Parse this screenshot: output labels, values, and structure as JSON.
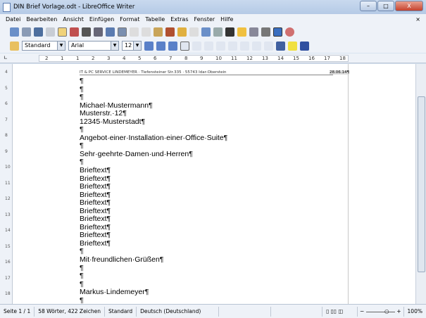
{
  "window": {
    "title": "DIN Brief Vorlage.odt - LibreOffice Writer",
    "minimize": "–",
    "maximize": "□",
    "close": "X"
  },
  "menu": [
    "Datei",
    "Bearbeiten",
    "Ansicht",
    "Einfügen",
    "Format",
    "Tabelle",
    "Extras",
    "Fenster",
    "Hilfe"
  ],
  "menu_close": "×",
  "format": {
    "style": "Standard",
    "font": "Arial",
    "size": "12"
  },
  "ruler": [
    "2",
    "1",
    "1",
    "2",
    "3",
    "4",
    "5",
    "6",
    "7",
    "8",
    "9",
    "10",
    "11",
    "12",
    "13",
    "14",
    "15",
    "16",
    "17",
    "18"
  ],
  "vruler": [
    "4",
    "5",
    "6",
    "7",
    "8",
    "9",
    "10",
    "11",
    "12",
    "13",
    "14",
    "15",
    "16",
    "17",
    "18"
  ],
  "document": {
    "header": "IT & PC SERVICE LINDEMEYER · Tiefensteiner Str.335 · 55743 Idar-Oberstein",
    "date": "28.06.14¶",
    "lines": [
      "¶",
      "¶",
      "¶",
      "Michael·Mustermann¶",
      "Musterstr.·12¶",
      "12345·Musterstadt¶",
      "¶",
      "Angebot·einer·Installation·einer·Office·Suite¶",
      "¶",
      "Sehr·geehrte·Damen·und·Herren¶",
      "¶",
      "Brieftext¶",
      "Brieftext¶",
      "Brieftext¶",
      "Brieftext¶",
      "Brieftext¶",
      "Brieftext¶",
      "Brieftext¶",
      "Brieftext¶",
      "Brieftext¶",
      "Brieftext¶",
      "¶",
      "Mit·freundlichen·Grüßen¶",
      "¶",
      "¶",
      "¶",
      "Markus·Lindemeyer¶",
      "¶"
    ]
  },
  "status": {
    "page": "Seite 1 / 1",
    "words": "58 Wörter, 422 Zeichen",
    "style": "Standard",
    "language": "Deutsch (Deutschland)",
    "zoom": "100%"
  }
}
